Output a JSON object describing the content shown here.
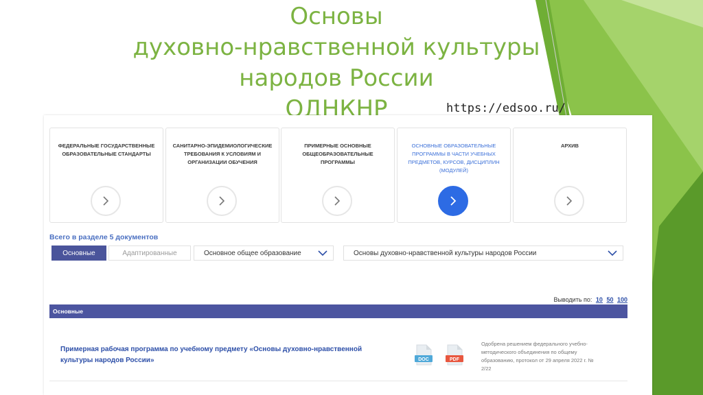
{
  "slide": {
    "title_lines": [
      "Основы",
      "духовно-нравственной культуры",
      "народов России",
      "ОДНКНР"
    ],
    "url": "https://edsoo.ru/",
    "accent_color": "#7cb342"
  },
  "cards": [
    {
      "label": "ФЕДЕРАЛЬНЫЕ ГОСУДАРСТВЕННЫЕ ОБРАЗОВАТЕЛЬНЫЕ СТАНДАРТЫ",
      "sub": "",
      "active": false
    },
    {
      "label": "САНИТАРНО-ЭПИДЕМИОЛОГИЧЕСКИЕ ТРЕБОВАНИЯ К УСЛОВИЯМ И ОРГАНИЗАЦИИ ОБУЧЕНИЯ",
      "sub": "",
      "active": false
    },
    {
      "label": "ПРИМЕРНЫЕ ОСНОВНЫЕ ОБЩЕОБРАЗОВАТЕЛЬНЫЕ ПРОГРАММЫ",
      "sub": "",
      "active": false
    },
    {
      "label": "ОСНОВНЫЕ ОБРАЗОВАТЕЛЬНЫЕ ПРОГРАММЫ В ЧАСТИ УЧЕБНЫХ ПРЕДМЕТОВ, КУРСОВ, ДИСЦИПЛИН",
      "sub": "(МОДУЛЕЙ)",
      "active": true
    },
    {
      "label": "АРХИВ",
      "sub": "",
      "active": false
    }
  ],
  "document_count": "Всего в разделе 5 документов",
  "filters": {
    "tab_main": "Основные",
    "tab_adapted": "Адаптированные",
    "level_select": "Основное общее образование",
    "subject_select": "Основы духовно-нравственной культуры народов России"
  },
  "per_page": {
    "label": "Выводить по:",
    "options": [
      "10",
      "50",
      "100"
    ]
  },
  "section_header": "Основные",
  "document": {
    "title": "Примерная рабочая программа по учебному предмету «Основы духовно-нравственной культуры народов России»",
    "doc_label": "DOC",
    "pdf_label": "PDF",
    "approval": "Одобрена решением федерального учебно-методического объединения по общему образованию, протокол от 29 апреля 2022 г. № 2/22"
  },
  "colors": {
    "primary": "#4c55a0",
    "link": "#2d4fa8",
    "active_button": "#2d6be4",
    "doc_icon": "#4fa9d9",
    "pdf_icon": "#e8573f"
  }
}
